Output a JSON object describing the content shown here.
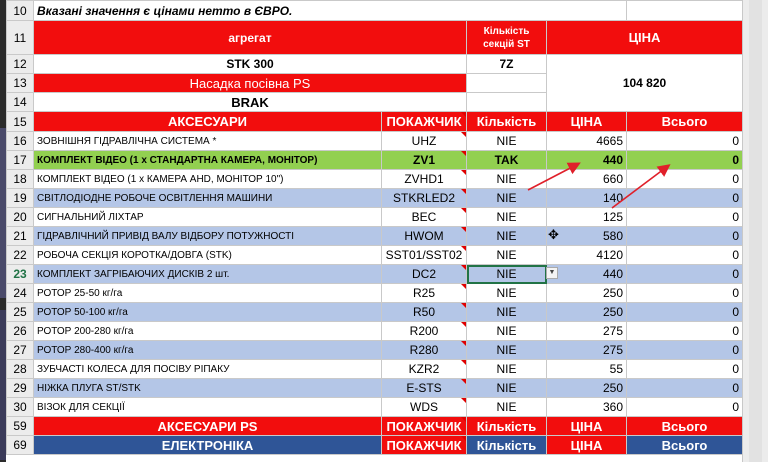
{
  "note_text": "Вказані значення є цінами нетто в ЄВРО.",
  "header": {
    "aggregate_label": "агрегат",
    "sections_label_line1": "Кількість",
    "sections_label_line2": "секцій ST",
    "price_label": "ЦІНА"
  },
  "machine": {
    "model": "STK 300",
    "sections": "7Z",
    "attachment": "Насадка посівна PS",
    "status": "BRAK",
    "price": "104 820"
  },
  "accessories_header": {
    "title": "АКСЕСУАРИ",
    "code": "ПОКАЖЧИК",
    "qty": "Кількість",
    "price": "ЦІНА",
    "total": "Всього"
  },
  "rows": [
    {
      "rn": "16",
      "name": "ЗОВНІШНЯ ГІДРАВЛІЧНА СИСТЕМА *",
      "code": "UHZ",
      "qty": "NIE",
      "price": "4665",
      "total": "0",
      "style": "white"
    },
    {
      "rn": "17",
      "name": "КОМПЛЕКТ ВІДЕО (1 х СТАНДАРТНА КАМЕРА, МОНІТОР)",
      "code": "ZV1",
      "qty": "TAK",
      "price": "440",
      "total": "0",
      "style": "green"
    },
    {
      "rn": "18",
      "name": "КОМПЛЕКТ ВІДЕО (1 х КАМЕРА AHD, МОНІТОР 10\")",
      "code": "ZVHD1",
      "qty": "NIE",
      "price": "660",
      "total": "0",
      "style": "white"
    },
    {
      "rn": "19",
      "name": "СВІТЛОДІОДНЕ РОБОЧЕ ОСВІТЛЕННЯ МАШИНИ",
      "code": "STKRLED2",
      "qty": "NIE",
      "price": "140",
      "total": "0",
      "style": "blue"
    },
    {
      "rn": "20",
      "name": "СИГНАЛЬНИЙ ЛІХТАР",
      "code": "BEC",
      "qty": "NIE",
      "price": "125",
      "total": "0",
      "style": "white"
    },
    {
      "rn": "21",
      "name": "ГІДРАВЛІЧНИЙ ПРИВІД ВАЛУ ВІДБОРУ ПОТУЖНОСТІ",
      "code": "HWOM",
      "qty": "NIE",
      "price": "580",
      "total": "0",
      "style": "blue"
    },
    {
      "rn": "22",
      "name": "РОБОЧА СЕКЦІЯ КОРОТКА/ДОВГА (STK)",
      "code": "SST01/SST02",
      "qty": "NIE",
      "price": "4120",
      "total": "0",
      "style": "white"
    },
    {
      "rn": "23",
      "name": "КОМПЛЕКТ ЗАГРІБАЮЧИХ ДИСКІВ 2 шт.",
      "code": "DC2",
      "qty": "NIE",
      "price": "440",
      "total": "0",
      "style": "blue"
    },
    {
      "rn": "24",
      "name": "РОТОР 25-50 кг/га",
      "code": "R25",
      "qty": "NIE",
      "price": "250",
      "total": "0",
      "style": "white"
    },
    {
      "rn": "25",
      "name": "РОТОР 50-100 кг/га",
      "code": "R50",
      "qty": "NIE",
      "price": "250",
      "total": "0",
      "style": "blue"
    },
    {
      "rn": "26",
      "name": "РОТОР 200-280 кг/га",
      "code": "R200",
      "qty": "NIE",
      "price": "275",
      "total": "0",
      "style": "white"
    },
    {
      "rn": "27",
      "name": "РОТОР 280-400 кг/га",
      "code": "R280",
      "qty": "NIE",
      "price": "275",
      "total": "0",
      "style": "blue"
    },
    {
      "rn": "28",
      "name": "ЗУБЧАСТІ КОЛЕСА ДЛЯ ПОСІВУ РІПАКУ",
      "code": "KZR2",
      "qty": "NIE",
      "price": "55",
      "total": "0",
      "style": "white"
    },
    {
      "rn": "29",
      "name": "НІЖКА ПЛУГА ST/STK",
      "code": "E-STS",
      "qty": "NIE",
      "price": "250",
      "total": "0",
      "style": "blue"
    },
    {
      "rn": "30",
      "name": "ВІЗОК ДЛЯ СЕКЦІЇ",
      "code": "WDS",
      "qty": "NIE",
      "price": "360",
      "total": "0",
      "style": "white"
    }
  ],
  "ps_header": {
    "title": "АКСЕСУАРИ PS",
    "code": "ПОКАЖЧИК",
    "qty": "Кількість",
    "price": "ЦІНА",
    "total": "Всього"
  },
  "el_header": {
    "title": "ЕЛЕКТРОНІКА",
    "code": "ПОКАЖЧИК",
    "qty": "Кількість",
    "price": "ЦІНА",
    "total": "Всього"
  },
  "row_numbers": {
    "r10": "10",
    "r11": "11",
    "r12": "12",
    "r13": "13",
    "r14": "14",
    "r15": "15",
    "r59": "59",
    "r69": "69"
  },
  "colors": {
    "red": "#f20d0d",
    "green": "#92d050",
    "blue": "#b4c6e7",
    "dark_blue": "#2f5597",
    "arrow": "#e0202a"
  }
}
